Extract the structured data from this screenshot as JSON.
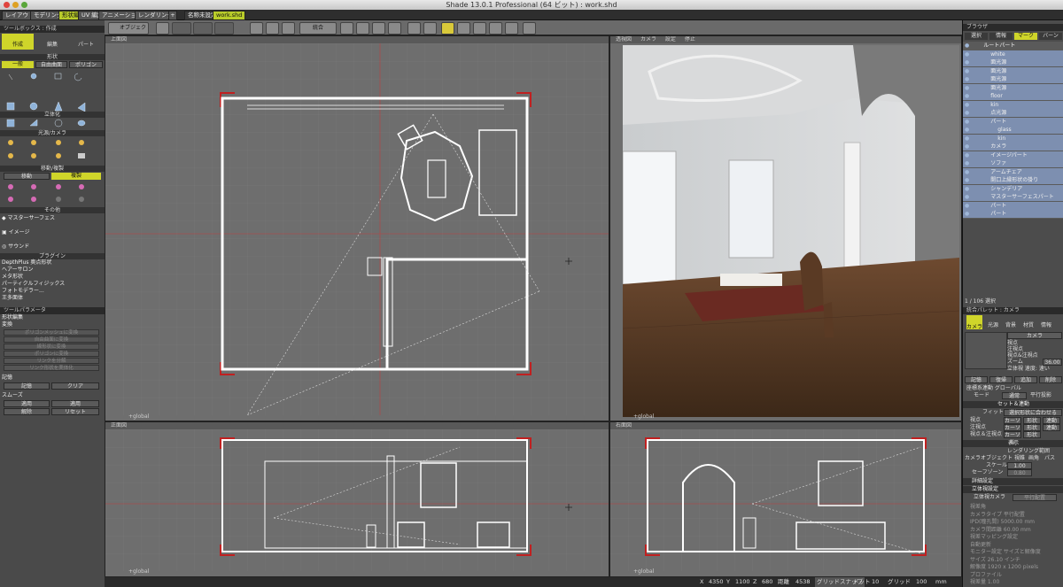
{
  "window": {
    "title": "Shade 13.0.1 Professional (64 ビット) : work.shd"
  },
  "tabs": [
    "レイアウト",
    "モデリング",
    "形状編",
    "UV 編集",
    "アニメーション",
    "レンダリング"
  ],
  "doc_tabs": [
    "名称未設定",
    "work.shd"
  ],
  "toolbar": {
    "object_label": "オブジェクト",
    "combine_label": "統合"
  },
  "toolbox": {
    "title": "ツールボックス : 作成",
    "mode_buttons": [
      "作成",
      "編集",
      "パート"
    ],
    "section_shape": "形状",
    "shape_tabs": [
      "一般",
      "自由曲面",
      "ポリゴン"
    ],
    "section_solid": "立体化",
    "section_light": "光源/カメラ",
    "section_move": "移動/複製",
    "move_tabs": [
      "移動",
      "複製"
    ],
    "section_other": "その他",
    "other_items": [
      "マスターサーフェス",
      "イメージ",
      "サウンド"
    ],
    "section_plugin": "プラグイン",
    "plugin_items": [
      "DepthPlus 奥点形状",
      "ヘアーサロン",
      "メタ形状",
      "パーティクルフィジックス",
      "フォトモデラー...",
      "王多面体"
    ]
  },
  "toolparams": {
    "title": "ツールパラメータ",
    "sub_title": "形状編集",
    "section_convert": "変換",
    "convert_buttons": [
      "ポリゴンメッシュに変換",
      "自由曲面に変換",
      "線形状に変換",
      "ポリゴンに変換",
      "リンクを分解",
      "リンク形状を実体化"
    ],
    "section_memory": "記憶",
    "memory_buttons": [
      "記憶",
      "クリア"
    ],
    "section_smooth": "スムーズ",
    "smooth_buttons": [
      "適用",
      "適用",
      "解除",
      "リセット"
    ]
  },
  "viewports": {
    "top": {
      "label": "上面図",
      "foot": "+global"
    },
    "persp": {
      "label": "透視図",
      "menus": [
        "カメラ",
        "設定",
        "停止"
      ],
      "foot": "+global"
    },
    "front": {
      "label": "正面図",
      "foot": "+global"
    },
    "side": {
      "label": "右面図",
      "foot": "+global"
    }
  },
  "status": {
    "x_label": "X",
    "x": "4350",
    "y_label": "Y",
    "y": "1100",
    "z_label": "Z",
    "z": "680",
    "dist_label": "距離",
    "dist": "4538",
    "grid_snap": "グリッドスナップ",
    "dot_label": "ドット",
    "dot": "10",
    "grid_label": "グリッド",
    "grid": "100",
    "unit": "mm"
  },
  "browser": {
    "title": "ブラウザ",
    "tabs": [
      "選択",
      "情報",
      "マーク",
      "バーン"
    ],
    "tree": [
      {
        "label": "ルートパート",
        "depth": 0,
        "selected": false
      },
      {
        "label": "white",
        "depth": 1,
        "selected": true
      },
      {
        "label": "面光源",
        "depth": 1,
        "selected": true
      },
      {
        "label": "面光源",
        "depth": 1,
        "selected": true
      },
      {
        "label": "面光源",
        "depth": 1,
        "selected": true
      },
      {
        "label": "面光源",
        "depth": 1,
        "selected": true
      },
      {
        "label": "floor",
        "depth": 1,
        "selected": true
      },
      {
        "label": "kin",
        "depth": 1,
        "selected": true
      },
      {
        "label": "点光源",
        "depth": 1,
        "selected": true
      },
      {
        "label": "パート",
        "depth": 1,
        "selected": true
      },
      {
        "label": "glass",
        "depth": 2,
        "selected": true
      },
      {
        "label": "kin",
        "depth": 2,
        "selected": true
      },
      {
        "label": "カメラ",
        "depth": 1,
        "selected": true
      },
      {
        "label": "イメージパート",
        "depth": 1,
        "selected": true
      },
      {
        "label": "ソファ",
        "depth": 1,
        "selected": true
      },
      {
        "label": "アームチェア",
        "depth": 1,
        "selected": true
      },
      {
        "label": "開口上縁形状の掛り",
        "depth": 1,
        "selected": true
      },
      {
        "label": "シャンデリア",
        "depth": 1,
        "selected": true
      },
      {
        "label": "マスターサーフェスパート",
        "depth": 1,
        "selected": true
      },
      {
        "label": "パート",
        "depth": 1,
        "selected": true
      },
      {
        "label": "パート",
        "depth": 1,
        "selected": true
      }
    ],
    "count": "1 / 106 選択"
  },
  "palette": {
    "title": "統合パレット : カメラ",
    "tabs": [
      "カメラ",
      "光源",
      "背景",
      "材質",
      "情報"
    ],
    "camera_select": "カメラ",
    "radio": [
      "視点",
      "注視点",
      "視点&注視点"
    ],
    "zoom_label": "ズーム",
    "zoom": "36.00",
    "stereo_label": "立体視 速度: 速い",
    "buttons1": [
      "記憶",
      "復帰",
      "追加",
      "削除"
    ],
    "coord_label": "座標系連動 グローバル",
    "mode_label": "モード",
    "mode_value": "通常",
    "parallel_label": "平行投影",
    "section_set": "セット＆連動",
    "fit_label": "フィット",
    "fit_value": "選択形状に合わせる",
    "vp_rows": [
      {
        "label": "視点",
        "a": "カーソル",
        "b": "形状",
        "c": "連動"
      },
      {
        "label": "注視点",
        "a": "カーソル",
        "b": "形状",
        "c": "連動"
      },
      {
        "label": "視点＆注視点",
        "a": "カーソル",
        "b": "形状",
        "c": ""
      }
    ],
    "section_display": "表示",
    "render_range": "レンダリング範囲",
    "camobj_label": "カメラオブジェクト",
    "camobj_opts": [
      "視錐",
      "画角",
      "パス"
    ],
    "scale_label": "スケール",
    "scale": "1.00",
    "safezone_label": "セーフゾーン",
    "safezone": "0.80",
    "section_detail": "詳細設定",
    "section_stereo": "立体視設定",
    "stereo_camera": "立体視カメラ",
    "stereo_cam_value": "平行配置",
    "dim_rows": [
      "視差角",
      "カメラタイプ 平行配置",
      "IPD(瞳孔間) 5000.00 mm",
      "カメラ間距離 60.00 mm",
      "視差マッピング設定",
      "自動更新",
      "モニター設定 サイズと解像度",
      "サイズ 26.10 インチ",
      "解像度 1920 x 1200 pixels",
      "プロファイル",
      "視差量 1.00"
    ]
  }
}
